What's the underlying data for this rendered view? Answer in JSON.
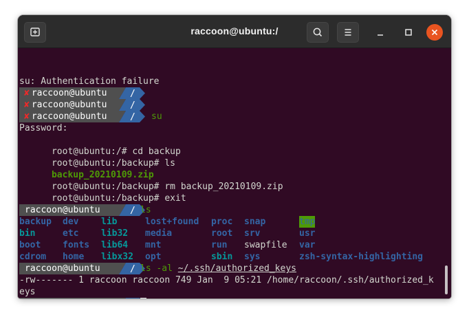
{
  "window": {
    "title": "raccoon@ubuntu:/"
  },
  "titlebar": {
    "new_tab_icon": "new-tab-icon",
    "search_icon": "search-icon",
    "menu_icon": "hamburger-menu-icon",
    "minimize_icon": "minimize-icon",
    "maximize_icon": "maximize-icon",
    "close_icon": "close-icon"
  },
  "colors": {
    "terminal_bg": "#300a24",
    "prompt_bg": "#4f4f4f",
    "prompt_dir_bg": "#3465a4",
    "error_red": "#ef2929",
    "green": "#4e9a06",
    "blue": "#3465a4",
    "cyan": "#06989a",
    "close_button": "#e95420"
  },
  "prompt": {
    "user_host": "raccoon@ubuntu",
    "dir": "/",
    "fail_mark": "✘"
  },
  "terminal": {
    "su_failure": "su: Authentication failure",
    "cmd_su": "su",
    "password": "Password:",
    "root_prompt_1": "root@ubuntu:/# ",
    "cmd_cd": "cd backup",
    "root_prompt_2": "root@ubuntu:/backup# ",
    "cmd_ls_root": "ls",
    "backup_file": "backup_20210109.zip",
    "root_prompt_3": "root@ubuntu:/backup# ",
    "cmd_rm": "rm backup_20210109.zip",
    "root_prompt_4": "root@ubuntu:/backup# ",
    "cmd_exit": "exit",
    "exit_output": "exit",
    "cmd_ls": "ls",
    "listing": [
      [
        "backup",
        "dev",
        "lib",
        "lost+found",
        "proc",
        "snap",
        "tmp"
      ],
      [
        "bin",
        "etc",
        "lib32",
        "media",
        "root",
        "srv",
        "usr"
      ],
      [
        "boot",
        "fonts",
        "lib64",
        "mnt",
        "run",
        "swapfile",
        "var"
      ],
      [
        "cdrom",
        "home",
        "libx32",
        "opt",
        "sbin",
        "sys",
        "zsh-syntax-highlighting"
      ]
    ],
    "cmd_ls_al": "ls -al ",
    "cmd_ls_al_path": "~/.ssh/authorized_keys",
    "ls_al_output_1": "-rw------- 1 raccoon raccoon 749 Jan  9 05:21 /home/raccoon/.ssh/authorized_k",
    "ls_al_output_2": "eys"
  }
}
